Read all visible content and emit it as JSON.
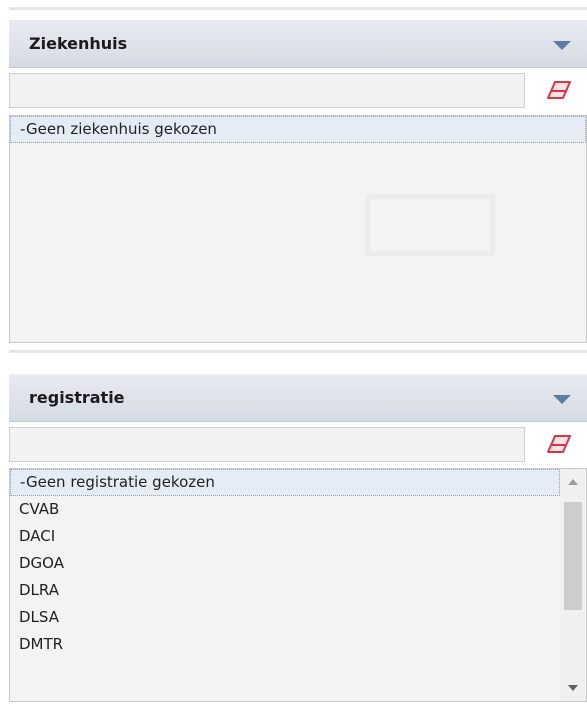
{
  "ziekenhuis": {
    "title": "Ziekenhuis",
    "filter_value": "",
    "items": [
      "-Geen ziekenhuis gekozen"
    ],
    "selected": "-Geen ziekenhuis gekozen"
  },
  "registratie": {
    "title": "registratie",
    "filter_value": "",
    "items": [
      "-Geen registratie gekozen",
      "CVAB",
      "DACI",
      "DGOA",
      "DLRA",
      "DLSA",
      "DMTR"
    ],
    "selected": "-Geen registratie gekozen"
  },
  "colors": {
    "header_bg": "#d6dbe3",
    "chevron": "#5b7ca3",
    "eraser": "#d9364a",
    "selected_bg": "#e6ecf6"
  },
  "icons": {
    "chevron": "chevron-down-icon",
    "eraser": "eraser-icon"
  }
}
